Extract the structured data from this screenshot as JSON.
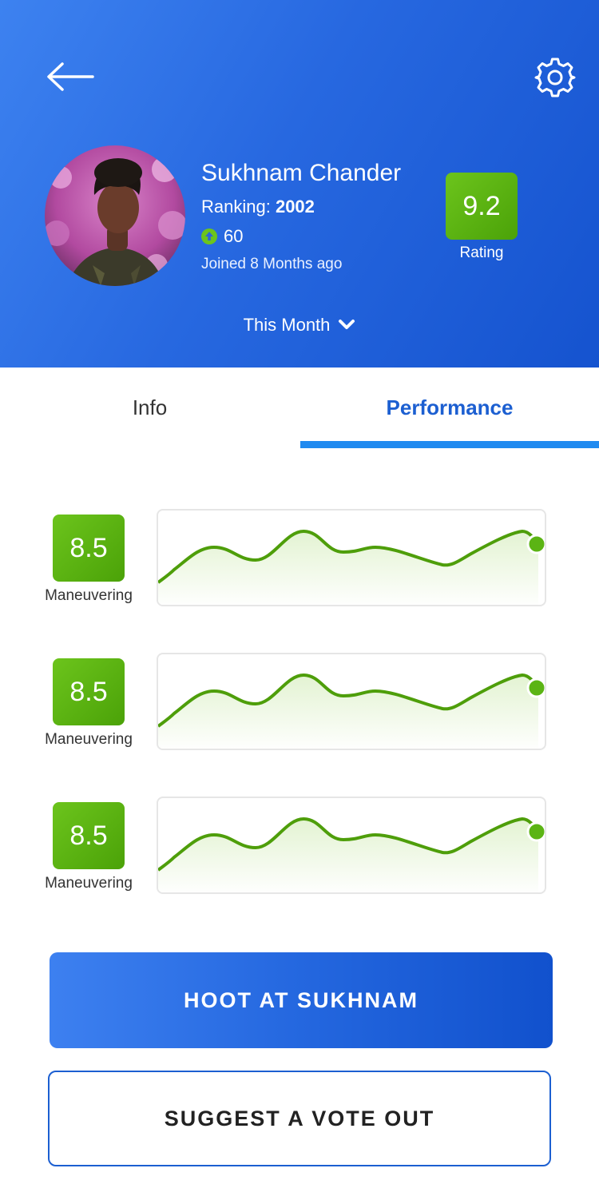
{
  "profile": {
    "name": "Sukhnam Chander",
    "ranking_label": "Ranking: ",
    "ranking_value": "2002",
    "points": "60",
    "joined": "Joined 8 Months ago",
    "rating_value": "9.2",
    "rating_label": "Rating"
  },
  "filter": {
    "period": "This Month"
  },
  "tabs": [
    {
      "label": "Info",
      "active": false
    },
    {
      "label": "Performance",
      "active": true
    }
  ],
  "metrics": [
    {
      "score": "8.5",
      "label": "Maneuvering"
    },
    {
      "score": "8.5",
      "label": "Maneuvering"
    },
    {
      "score": "8.5",
      "label": "Maneuvering"
    }
  ],
  "actions": {
    "primary": "HOOT AT SUKHNAM",
    "secondary": "SUGGEST A VOTE OUT"
  },
  "colors": {
    "header_start": "#3d82f0",
    "header_end": "#1553cf",
    "score_green": "#5bb414",
    "line_green": "#4e9e0a",
    "tab_active": "#1c5fd1",
    "tab_underline": "#1f8af0"
  },
  "icons": {
    "back": "arrow-left-icon",
    "settings": "gear-icon",
    "points": "arrow-up-circle-icon",
    "period": "chevron-down-icon"
  }
}
